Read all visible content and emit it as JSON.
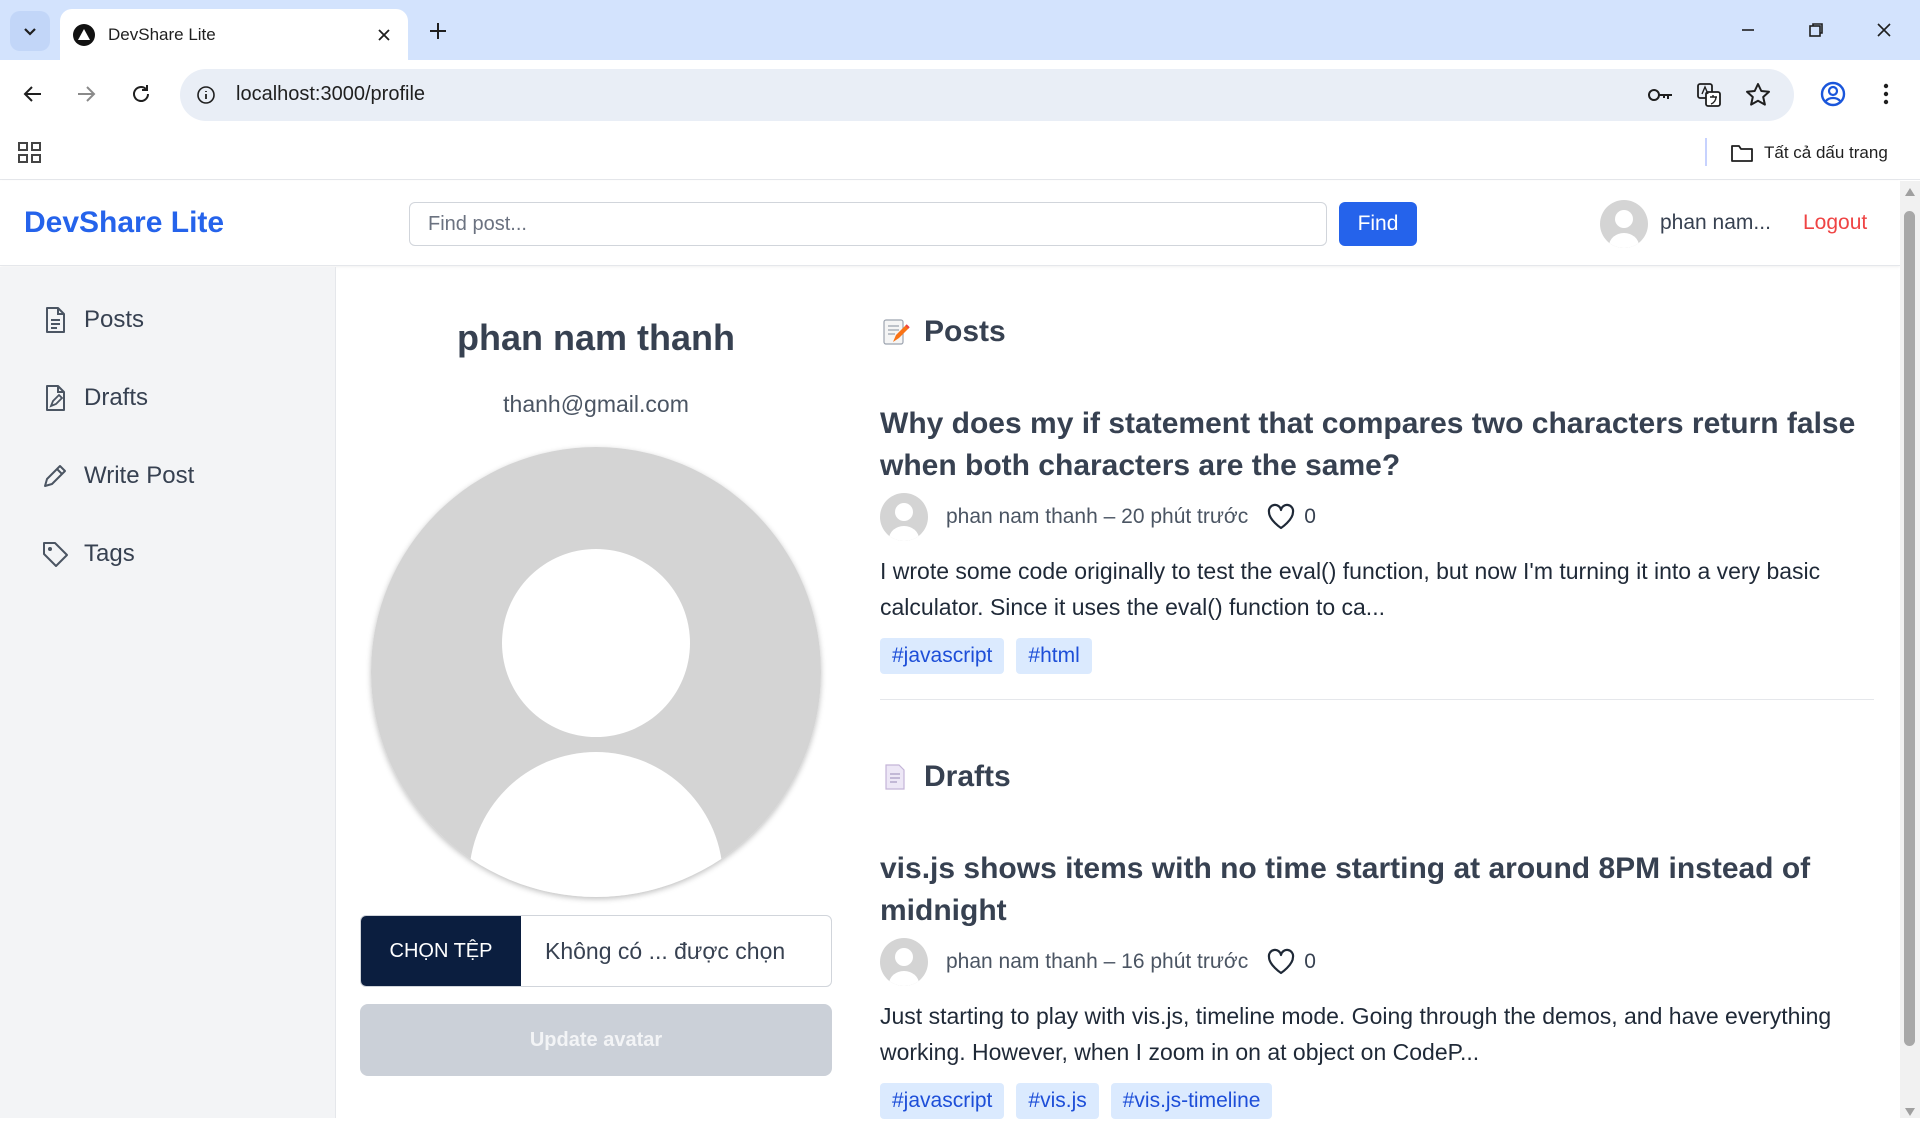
{
  "browser": {
    "tab_title": "DevShare Lite",
    "url": "localhost:3000/profile",
    "bookmarks_all_label": "Tất cả dấu trang"
  },
  "header": {
    "brand": "DevShare Lite",
    "search_placeholder": "Find post...",
    "find_label": "Find",
    "username": "phan nam...",
    "logout_label": "Logout"
  },
  "sidebar": {
    "items": [
      {
        "label": "Posts",
        "icon": "document-icon"
      },
      {
        "label": "Drafts",
        "icon": "draft-icon"
      },
      {
        "label": "Write Post",
        "icon": "pencil-icon"
      },
      {
        "label": "Tags",
        "icon": "tag-icon"
      }
    ]
  },
  "profile": {
    "name": "phan nam thanh",
    "email": "thanh@gmail.com",
    "choose_file_label": "CHỌN TỆP",
    "file_status": "Không có ... được chọn",
    "update_avatar_label": "Update avatar"
  },
  "posts_section": {
    "title": "Posts",
    "items": [
      {
        "title": "Why does my if statement that compares two characters return false when both characters are the same?",
        "meta": "phan nam thanh – 20 phút trước",
        "likes": "0",
        "excerpt": "I wrote some code originally to test the eval() function, but now I'm turning it into a very basic calculator. Since it uses the eval() function to ca...",
        "tags": [
          "#javascript",
          "#html"
        ]
      }
    ]
  },
  "drafts_section": {
    "title": "Drafts",
    "items": [
      {
        "title": "vis.js shows items with no time starting at around 8PM instead of midnight",
        "meta": "phan nam thanh – 16 phút trước",
        "likes": "0",
        "excerpt": "Just starting to play with vis.js, timeline mode. Going through the demos, and have everything working. However, when I zoom in on at object on CodeP...",
        "tags": [
          "#javascript",
          "#vis.js",
          "#vis.js-timeline"
        ]
      }
    ]
  },
  "colors": {
    "brand": "#2563eb",
    "logout": "#ef4444",
    "tag_bg": "#dbeafe",
    "tag_text": "#1d4ed8",
    "file_button": "#0b1e3f"
  }
}
